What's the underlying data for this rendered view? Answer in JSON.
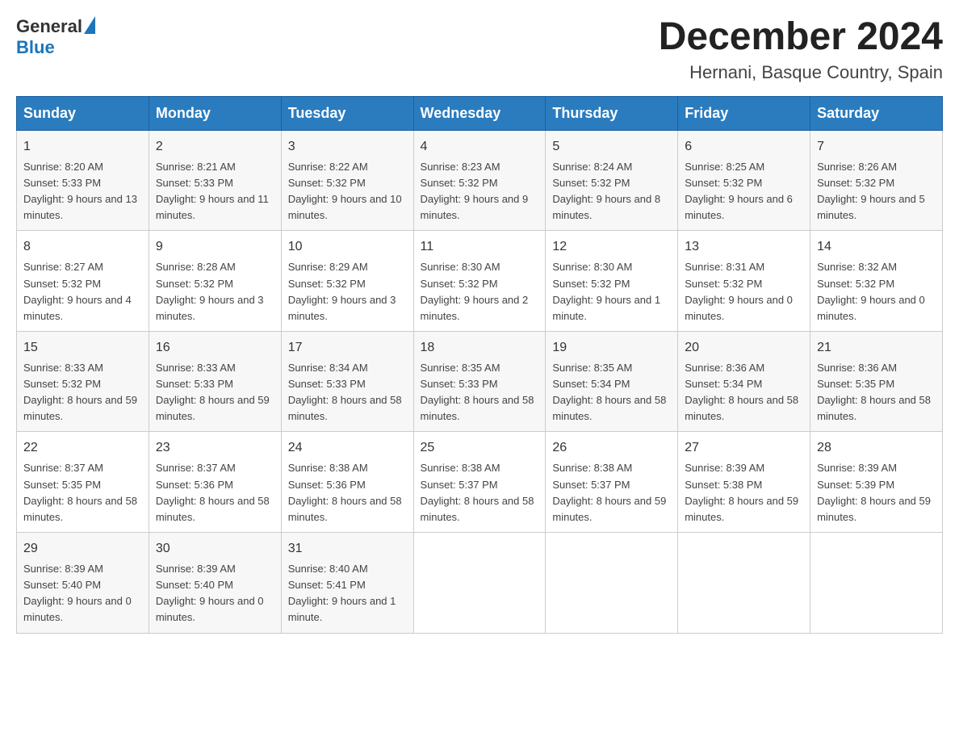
{
  "header": {
    "logo": {
      "text_general": "General",
      "text_blue": "Blue"
    },
    "title": "December 2024",
    "subtitle": "Hernani, Basque Country, Spain"
  },
  "days_of_week": [
    "Sunday",
    "Monday",
    "Tuesday",
    "Wednesday",
    "Thursday",
    "Friday",
    "Saturday"
  ],
  "weeks": [
    [
      {
        "day": "1",
        "sunrise": "8:20 AM",
        "sunset": "5:33 PM",
        "daylight": "9 hours and 13 minutes."
      },
      {
        "day": "2",
        "sunrise": "8:21 AM",
        "sunset": "5:33 PM",
        "daylight": "9 hours and 11 minutes."
      },
      {
        "day": "3",
        "sunrise": "8:22 AM",
        "sunset": "5:32 PM",
        "daylight": "9 hours and 10 minutes."
      },
      {
        "day": "4",
        "sunrise": "8:23 AM",
        "sunset": "5:32 PM",
        "daylight": "9 hours and 9 minutes."
      },
      {
        "day": "5",
        "sunrise": "8:24 AM",
        "sunset": "5:32 PM",
        "daylight": "9 hours and 8 minutes."
      },
      {
        "day": "6",
        "sunrise": "8:25 AM",
        "sunset": "5:32 PM",
        "daylight": "9 hours and 6 minutes."
      },
      {
        "day": "7",
        "sunrise": "8:26 AM",
        "sunset": "5:32 PM",
        "daylight": "9 hours and 5 minutes."
      }
    ],
    [
      {
        "day": "8",
        "sunrise": "8:27 AM",
        "sunset": "5:32 PM",
        "daylight": "9 hours and 4 minutes."
      },
      {
        "day": "9",
        "sunrise": "8:28 AM",
        "sunset": "5:32 PM",
        "daylight": "9 hours and 3 minutes."
      },
      {
        "day": "10",
        "sunrise": "8:29 AM",
        "sunset": "5:32 PM",
        "daylight": "9 hours and 3 minutes."
      },
      {
        "day": "11",
        "sunrise": "8:30 AM",
        "sunset": "5:32 PM",
        "daylight": "9 hours and 2 minutes."
      },
      {
        "day": "12",
        "sunrise": "8:30 AM",
        "sunset": "5:32 PM",
        "daylight": "9 hours and 1 minute."
      },
      {
        "day": "13",
        "sunrise": "8:31 AM",
        "sunset": "5:32 PM",
        "daylight": "9 hours and 0 minutes."
      },
      {
        "day": "14",
        "sunrise": "8:32 AM",
        "sunset": "5:32 PM",
        "daylight": "9 hours and 0 minutes."
      }
    ],
    [
      {
        "day": "15",
        "sunrise": "8:33 AM",
        "sunset": "5:32 PM",
        "daylight": "8 hours and 59 minutes."
      },
      {
        "day": "16",
        "sunrise": "8:33 AM",
        "sunset": "5:33 PM",
        "daylight": "8 hours and 59 minutes."
      },
      {
        "day": "17",
        "sunrise": "8:34 AM",
        "sunset": "5:33 PM",
        "daylight": "8 hours and 58 minutes."
      },
      {
        "day": "18",
        "sunrise": "8:35 AM",
        "sunset": "5:33 PM",
        "daylight": "8 hours and 58 minutes."
      },
      {
        "day": "19",
        "sunrise": "8:35 AM",
        "sunset": "5:34 PM",
        "daylight": "8 hours and 58 minutes."
      },
      {
        "day": "20",
        "sunrise": "8:36 AM",
        "sunset": "5:34 PM",
        "daylight": "8 hours and 58 minutes."
      },
      {
        "day": "21",
        "sunrise": "8:36 AM",
        "sunset": "5:35 PM",
        "daylight": "8 hours and 58 minutes."
      }
    ],
    [
      {
        "day": "22",
        "sunrise": "8:37 AM",
        "sunset": "5:35 PM",
        "daylight": "8 hours and 58 minutes."
      },
      {
        "day": "23",
        "sunrise": "8:37 AM",
        "sunset": "5:36 PM",
        "daylight": "8 hours and 58 minutes."
      },
      {
        "day": "24",
        "sunrise": "8:38 AM",
        "sunset": "5:36 PM",
        "daylight": "8 hours and 58 minutes."
      },
      {
        "day": "25",
        "sunrise": "8:38 AM",
        "sunset": "5:37 PM",
        "daylight": "8 hours and 58 minutes."
      },
      {
        "day": "26",
        "sunrise": "8:38 AM",
        "sunset": "5:37 PM",
        "daylight": "8 hours and 59 minutes."
      },
      {
        "day": "27",
        "sunrise": "8:39 AM",
        "sunset": "5:38 PM",
        "daylight": "8 hours and 59 minutes."
      },
      {
        "day": "28",
        "sunrise": "8:39 AM",
        "sunset": "5:39 PM",
        "daylight": "8 hours and 59 minutes."
      }
    ],
    [
      {
        "day": "29",
        "sunrise": "8:39 AM",
        "sunset": "5:40 PM",
        "daylight": "9 hours and 0 minutes."
      },
      {
        "day": "30",
        "sunrise": "8:39 AM",
        "sunset": "5:40 PM",
        "daylight": "9 hours and 0 minutes."
      },
      {
        "day": "31",
        "sunrise": "8:40 AM",
        "sunset": "5:41 PM",
        "daylight": "9 hours and 1 minute."
      },
      null,
      null,
      null,
      null
    ]
  ]
}
